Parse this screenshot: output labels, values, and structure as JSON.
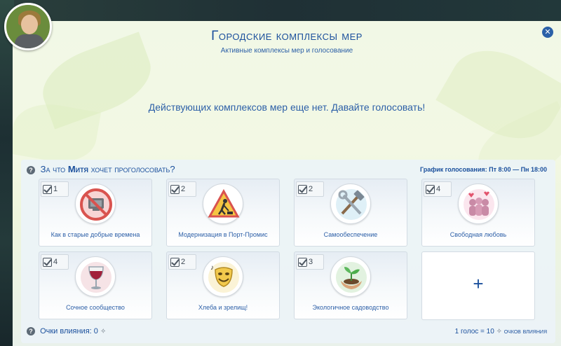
{
  "header": {
    "title": "Городские комплексы мер",
    "subtitle": "Активные комплексы мер и голосование",
    "close_label": "✕"
  },
  "notice": "Действующих комплексов мер еще нет. Давайте голосовать!",
  "voting": {
    "question_prefix": "За что",
    "sim_name": "Митя",
    "question_suffix": "хочет проголосовать?",
    "schedule_label": "График голосования:",
    "schedule_value": "Пт 8:00 — Пн 18:00"
  },
  "policies": [
    {
      "label": "Как в старые добрые времена",
      "votes": "1",
      "icon": "no-tv-icon"
    },
    {
      "label": "Модернизация в Порт-Промис",
      "votes": "2",
      "icon": "roadworks-icon"
    },
    {
      "label": "Самообеспечение",
      "votes": "2",
      "icon": "tools-icon"
    },
    {
      "label": "Свободная любовь",
      "votes": "4",
      "icon": "hearts-people-icon"
    },
    {
      "label": "Сочное сообщество",
      "votes": "4",
      "icon": "wine-glass-icon"
    },
    {
      "label": "Хлеба и зрелищ!",
      "votes": "2",
      "icon": "theater-mask-icon"
    },
    {
      "label": "Экологичное садоводство",
      "votes": "3",
      "icon": "sprout-hands-icon"
    }
  ],
  "add_policy_label": "+",
  "footer": {
    "influence_label": "Очки влияния: 0",
    "rate_prefix": "1 голос = 10",
    "rate_suffix": "очков влияния"
  },
  "colors": {
    "accent": "#1a4f9c",
    "text_blue": "#2c5fa7"
  }
}
